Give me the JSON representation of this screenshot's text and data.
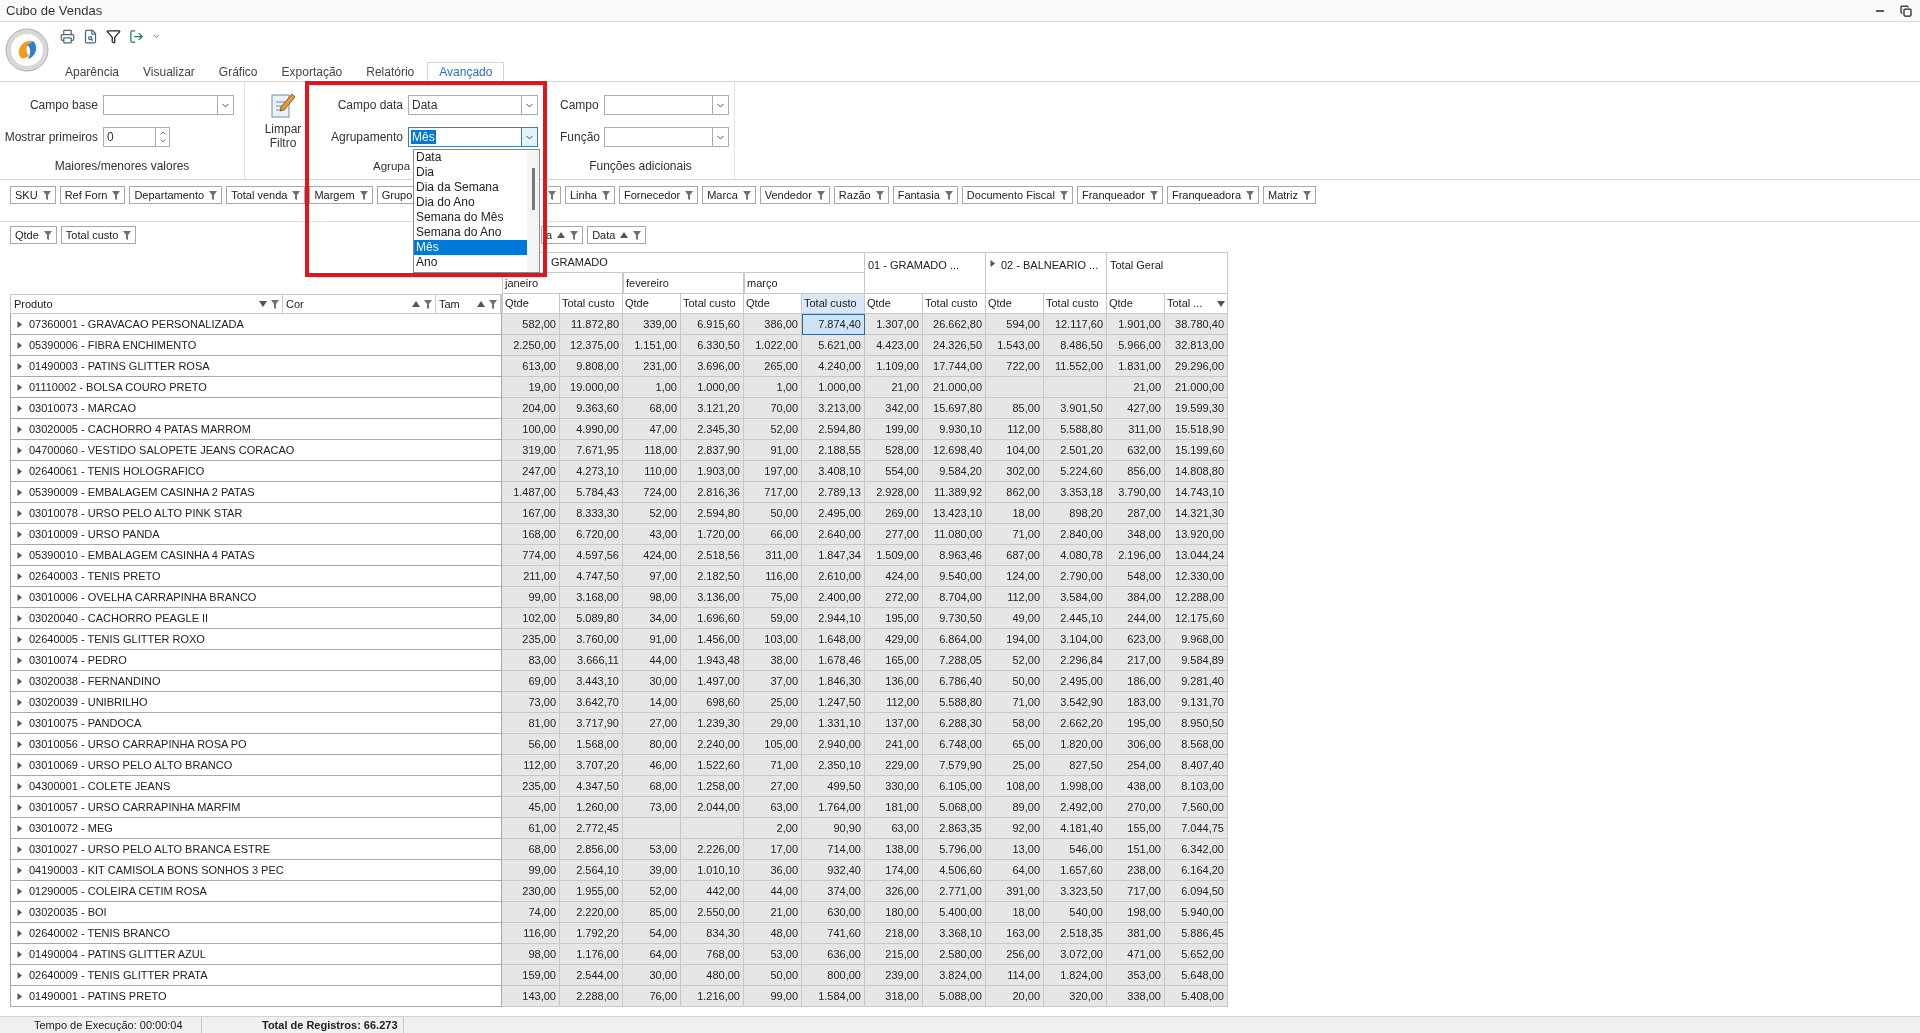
{
  "window": {
    "title": "Cubo de Vendas"
  },
  "tabs": [
    {
      "label": "Aparência",
      "selected": false
    },
    {
      "label": "Visualizar",
      "selected": false
    },
    {
      "label": "Gráfico",
      "selected": false
    },
    {
      "label": "Exportação",
      "selected": false
    },
    {
      "label": "Relatório",
      "selected": false
    },
    {
      "label": "Avançado",
      "selected": true
    }
  ],
  "top_values": {
    "caption": "Maiores/menores valores",
    "base_field": {
      "label": "Campo base"
    },
    "show_first": {
      "label": "Mostrar primeiros",
      "value": "0"
    }
  },
  "clear_filter": {
    "label": "Limpar Filtro"
  },
  "date_grouping": {
    "caption": "Agrupa",
    "date_field": {
      "label": "Campo data",
      "value": "Data"
    },
    "grouping": {
      "label": "Agrupamento",
      "value": "Mês",
      "expanded": true,
      "options": [
        {
          "label": "Data",
          "selected": false
        },
        {
          "label": "Dia",
          "selected": false
        },
        {
          "label": "Dia da Semana",
          "selected": false
        },
        {
          "label": "Dia do Ano",
          "selected": false
        },
        {
          "label": "Semana do Mês",
          "selected": false
        },
        {
          "label": "Semana do Ano",
          "selected": false
        },
        {
          "label": "Mês",
          "selected": true
        },
        {
          "label": "Ano",
          "selected": false
        }
      ]
    }
  },
  "extra_functions": {
    "caption": "Funções adicionais",
    "field": {
      "label": "Campo"
    },
    "function": {
      "label": "Função"
    }
  },
  "filter_fields_left": [
    "SKU",
    "Ref Forn",
    "Departamento",
    "Total venda",
    "Margem",
    "Grupo"
  ],
  "filter_fields_right": [
    "Linha",
    "Fornecedor",
    "Marca",
    "Vendedor",
    "Razão",
    "Fantasia",
    "Documento Fiscal",
    "Franqueador",
    "Franqueadora",
    "Matriz"
  ],
  "data_fields": [
    "Qtde",
    "Total custo"
  ],
  "column_fields": [
    {
      "label": "a",
      "sort_ascending": true
    },
    {
      "label": "Data",
      "sort_ascending": true
    }
  ],
  "pivot": {
    "row_fields": [
      {
        "label": "Produto",
        "sort_ascending": false
      },
      {
        "label": "Cor",
        "sort_ascending": true
      },
      {
        "label": "Tam",
        "sort_ascending": true
      }
    ],
    "store_header": "GRAMADO",
    "months": [
      "janeiro",
      "fevereiro",
      "março"
    ],
    "totals": [
      {
        "label": "01 - GRAMADO ..."
      },
      {
        "label": "02 - BALNEARIO ...",
        "expanded": false
      },
      {
        "label": "Total Geral"
      }
    ],
    "measures": [
      {
        "label": "Qtde",
        "selected": false
      },
      {
        "label": "Total custo",
        "selected": false
      },
      {
        "label": "Qtde",
        "selected": false
      },
      {
        "label": "Total custo",
        "selected": false
      },
      {
        "label": "Qtde",
        "selected": false
      },
      {
        "label": "Total custo",
        "selected": true
      },
      {
        "label": "Qtde",
        "selected": false
      },
      {
        "label": "Total custo",
        "selected": false
      },
      {
        "label": "Qtde",
        "selected": false
      },
      {
        "label": "Total custo",
        "selected": false
      },
      {
        "label": "Qtde",
        "selected": false
      },
      {
        "label": "Total ...",
        "selected": false,
        "sort_ascending": false
      }
    ],
    "rows": [
      {
        "product": "07360001 - GRAVACAO PERSONALIZADA",
        "expanded": false,
        "selected": true,
        "janeiro": [
          "582,00",
          "11.872,80"
        ],
        "fevereiro": [
          "339,00",
          "6.915,60"
        ],
        "marco": [
          "386,00",
          "7.874,40"
        ],
        "gramado_total": [
          "1.307,00",
          "26.662,80"
        ],
        "balneario_total": [
          "594,00",
          "12.117,60"
        ],
        "total_geral": [
          "1.901,00",
          "38.780,40"
        ]
      },
      {
        "product": "05390006 - FIBRA ENCHIMENTO",
        "expanded": false,
        "selected": false,
        "janeiro": [
          "2.250,00",
          "12.375,00"
        ],
        "fevereiro": [
          "1.151,00",
          "6.330,50"
        ],
        "marco": [
          "1.022,00",
          "5.621,00"
        ],
        "gramado_total": [
          "4.423,00",
          "24.326,50"
        ],
        "balneario_total": [
          "1.543,00",
          "8.486,50"
        ],
        "total_geral": [
          "5.966,00",
          "32.813,00"
        ]
      },
      {
        "product": "01490003 - PATINS GLITTER ROSA",
        "expanded": false,
        "selected": false,
        "janeiro": [
          "613,00",
          "9.808,00"
        ],
        "fevereiro": [
          "231,00",
          "3.696,00"
        ],
        "marco": [
          "265,00",
          "4.240,00"
        ],
        "gramado_total": [
          "1.109,00",
          "17.744,00"
        ],
        "balneario_total": [
          "722,00",
          "11.552,00"
        ],
        "total_geral": [
          "1.831,00",
          "29.296,00"
        ]
      },
      {
        "product": "01110002 - BOLSA COURO PRETO",
        "expanded": false,
        "selected": false,
        "janeiro": [
          "19,00",
          "19.000,00"
        ],
        "fevereiro": [
          "1,00",
          "1.000,00"
        ],
        "marco": [
          "1,00",
          "1.000,00"
        ],
        "gramado_total": [
          "21,00",
          "21.000,00"
        ],
        "total_geral": [
          "21,00",
          "21.000,00"
        ]
      },
      {
        "product": "03010073 - MARCAO",
        "expanded": false,
        "selected": false,
        "janeiro": [
          "204,00",
          "9.363,60"
        ],
        "fevereiro": [
          "68,00",
          "3.121,20"
        ],
        "marco": [
          "70,00",
          "3.213,00"
        ],
        "gramado_total": [
          "342,00",
          "15.697,80"
        ],
        "balneario_total": [
          "85,00",
          "3.901,50"
        ],
        "total_geral": [
          "427,00",
          "19.599,30"
        ]
      },
      {
        "product": "03020005 - CACHORRO 4 PATAS MARROM",
        "expanded": false,
        "selected": false,
        "janeiro": [
          "100,00",
          "4.990,00"
        ],
        "fevereiro": [
          "47,00",
          "2.345,30"
        ],
        "marco": [
          "52,00",
          "2.594,80"
        ],
        "gramado_total": [
          "199,00",
          "9.930,10"
        ],
        "balneario_total": [
          "112,00",
          "5.588,80"
        ],
        "total_geral": [
          "311,00",
          "15.518,90"
        ]
      },
      {
        "product": "04700060 - VESTIDO SALOPETE JEANS CORACAO",
        "expanded": false,
        "selected": false,
        "janeiro": [
          "319,00",
          "7.671,95"
        ],
        "fevereiro": [
          "118,00",
          "2.837,90"
        ],
        "marco": [
          "91,00",
          "2.188,55"
        ],
        "gramado_total": [
          "528,00",
          "12.698,40"
        ],
        "balneario_total": [
          "104,00",
          "2.501,20"
        ],
        "total_geral": [
          "632,00",
          "15.199,60"
        ]
      },
      {
        "product": "02640061 - TENIS HOLOGRAFICO",
        "expanded": false,
        "selected": false,
        "janeiro": [
          "247,00",
          "4.273,10"
        ],
        "fevereiro": [
          "110,00",
          "1.903,00"
        ],
        "marco": [
          "197,00",
          "3.408,10"
        ],
        "gramado_total": [
          "554,00",
          "9.584,20"
        ],
        "balneario_total": [
          "302,00",
          "5.224,60"
        ],
        "total_geral": [
          "856,00",
          "14.808,80"
        ]
      },
      {
        "product": "05390009 - EMBALAGEM CASINHA 2 PATAS",
        "expanded": false,
        "selected": false,
        "janeiro": [
          "1.487,00",
          "5.784,43"
        ],
        "fevereiro": [
          "724,00",
          "2.816,36"
        ],
        "marco": [
          "717,00",
          "2.789,13"
        ],
        "gramado_total": [
          "2.928,00",
          "11.389,92"
        ],
        "balneario_total": [
          "862,00",
          "3.353,18"
        ],
        "total_geral": [
          "3.790,00",
          "14.743,10"
        ]
      },
      {
        "product": "03010078 - URSO PELO ALTO PINK STAR",
        "expanded": false,
        "selected": false,
        "janeiro": [
          "167,00",
          "8.333,30"
        ],
        "fevereiro": [
          "52,00",
          "2.594,80"
        ],
        "marco": [
          "50,00",
          "2.495,00"
        ],
        "gramado_total": [
          "269,00",
          "13.423,10"
        ],
        "balneario_total": [
          "18,00",
          "898,20"
        ],
        "total_geral": [
          "287,00",
          "14.321,30"
        ]
      },
      {
        "product": "03010009 - URSO PANDA",
        "expanded": false,
        "selected": false,
        "janeiro": [
          "168,00",
          "6.720,00"
        ],
        "fevereiro": [
          "43,00",
          "1.720,00"
        ],
        "marco": [
          "66,00",
          "2.640,00"
        ],
        "gramado_total": [
          "277,00",
          "11.080,00"
        ],
        "balneario_total": [
          "71,00",
          "2.840,00"
        ],
        "total_geral": [
          "348,00",
          "13.920,00"
        ]
      },
      {
        "product": "05390010 - EMBALAGEM CASINHA 4 PATAS",
        "expanded": false,
        "selected": false,
        "janeiro": [
          "774,00",
          "4.597,56"
        ],
        "fevereiro": [
          "424,00",
          "2.518,56"
        ],
        "marco": [
          "311,00",
          "1.847,34"
        ],
        "gramado_total": [
          "1.509,00",
          "8.963,46"
        ],
        "balneario_total": [
          "687,00",
          "4.080,78"
        ],
        "total_geral": [
          "2.196,00",
          "13.044,24"
        ]
      },
      {
        "product": "02640003 - TENIS PRETO",
        "expanded": false,
        "selected": false,
        "janeiro": [
          "211,00",
          "4.747,50"
        ],
        "fevereiro": [
          "97,00",
          "2.182,50"
        ],
        "marco": [
          "116,00",
          "2.610,00"
        ],
        "gramado_total": [
          "424,00",
          "9.540,00"
        ],
        "balneario_total": [
          "124,00",
          "2.790,00"
        ],
        "total_geral": [
          "548,00",
          "12.330,00"
        ]
      },
      {
        "product": "03010006 - OVELHA CARRAPINHA BRANCO",
        "expanded": false,
        "selected": false,
        "janeiro": [
          "99,00",
          "3.168,00"
        ],
        "fevereiro": [
          "98,00",
          "3.136,00"
        ],
        "marco": [
          "75,00",
          "2.400,00"
        ],
        "gramado_total": [
          "272,00",
          "8.704,00"
        ],
        "balneario_total": [
          "112,00",
          "3.584,00"
        ],
        "total_geral": [
          "384,00",
          "12.288,00"
        ]
      },
      {
        "product": "03020040 - CACHORRO PEAGLE II",
        "expanded": false,
        "selected": false,
        "janeiro": [
          "102,00",
          "5.089,80"
        ],
        "fevereiro": [
          "34,00",
          "1.696,60"
        ],
        "marco": [
          "59,00",
          "2.944,10"
        ],
        "gramado_total": [
          "195,00",
          "9.730,50"
        ],
        "balneario_total": [
          "49,00",
          "2.445,10"
        ],
        "total_geral": [
          "244,00",
          "12.175,60"
        ]
      },
      {
        "product": "02640005 - TENIS GLITTER ROXO",
        "expanded": false,
        "selected": false,
        "janeiro": [
          "235,00",
          "3.760,00"
        ],
        "fevereiro": [
          "91,00",
          "1.456,00"
        ],
        "marco": [
          "103,00",
          "1.648,00"
        ],
        "gramado_total": [
          "429,00",
          "6.864,00"
        ],
        "balneario_total": [
          "194,00",
          "3.104,00"
        ],
        "total_geral": [
          "623,00",
          "9.968,00"
        ]
      },
      {
        "product": "03010074 - PEDRO",
        "expanded": false,
        "selected": false,
        "janeiro": [
          "83,00",
          "3.666,11"
        ],
        "fevereiro": [
          "44,00",
          "1.943,48"
        ],
        "marco": [
          "38,00",
          "1.678,46"
        ],
        "gramado_total": [
          "165,00",
          "7.288,05"
        ],
        "balneario_total": [
          "52,00",
          "2.296,84"
        ],
        "total_geral": [
          "217,00",
          "9.584,89"
        ]
      },
      {
        "product": "03020038 - FERNANDINO",
        "expanded": false,
        "selected": false,
        "janeiro": [
          "69,00",
          "3.443,10"
        ],
        "fevereiro": [
          "30,00",
          "1.497,00"
        ],
        "marco": [
          "37,00",
          "1.846,30"
        ],
        "gramado_total": [
          "136,00",
          "6.786,40"
        ],
        "balneario_total": [
          "50,00",
          "2.495,00"
        ],
        "total_geral": [
          "186,00",
          "9.281,40"
        ]
      },
      {
        "product": "03020039 - UNIBRILHO",
        "expanded": false,
        "selected": false,
        "janeiro": [
          "73,00",
          "3.642,70"
        ],
        "fevereiro": [
          "14,00",
          "698,60"
        ],
        "marco": [
          "25,00",
          "1.247,50"
        ],
        "gramado_total": [
          "112,00",
          "5.588,80"
        ],
        "balneario_total": [
          "71,00",
          "3.542,90"
        ],
        "total_geral": [
          "183,00",
          "9.131,70"
        ]
      },
      {
        "product": "03010075 - PANDOCA",
        "expanded": false,
        "selected": false,
        "janeiro": [
          "81,00",
          "3.717,90"
        ],
        "fevereiro": [
          "27,00",
          "1.239,30"
        ],
        "marco": [
          "29,00",
          "1.331,10"
        ],
        "gramado_total": [
          "137,00",
          "6.288,30"
        ],
        "balneario_total": [
          "58,00",
          "2.662,20"
        ],
        "total_geral": [
          "195,00",
          "8.950,50"
        ]
      },
      {
        "product": "03010056 - URSO CARRAPINHA ROSA PO",
        "expanded": false,
        "selected": false,
        "janeiro": [
          "56,00",
          "1.568,00"
        ],
        "fevereiro": [
          "80,00",
          "2.240,00"
        ],
        "marco": [
          "105,00",
          "2.940,00"
        ],
        "gramado_total": [
          "241,00",
          "6.748,00"
        ],
        "balneario_total": [
          "65,00",
          "1.820,00"
        ],
        "total_geral": [
          "306,00",
          "8.568,00"
        ]
      },
      {
        "product": "03010069 - URSO PELO ALTO BRANCO",
        "expanded": false,
        "selected": false,
        "janeiro": [
          "112,00",
          "3.707,20"
        ],
        "fevereiro": [
          "46,00",
          "1.522,60"
        ],
        "marco": [
          "71,00",
          "2.350,10"
        ],
        "gramado_total": [
          "229,00",
          "7.579,90"
        ],
        "balneario_total": [
          "25,00",
          "827,50"
        ],
        "total_geral": [
          "254,00",
          "8.407,40"
        ]
      },
      {
        "product": "04300001 - COLETE JEANS",
        "expanded": false,
        "selected": false,
        "janeiro": [
          "235,00",
          "4.347,50"
        ],
        "fevereiro": [
          "68,00",
          "1.258,00"
        ],
        "marco": [
          "27,00",
          "499,50"
        ],
        "gramado_total": [
          "330,00",
          "6.105,00"
        ],
        "balneario_total": [
          "108,00",
          "1.998,00"
        ],
        "total_geral": [
          "438,00",
          "8.103,00"
        ]
      },
      {
        "product": "03010057 - URSO CARRAPINHA MARFIM",
        "expanded": false,
        "selected": false,
        "janeiro": [
          "45,00",
          "1.260,00"
        ],
        "fevereiro": [
          "73,00",
          "2.044,00"
        ],
        "marco": [
          "63,00",
          "1.764,00"
        ],
        "gramado_total": [
          "181,00",
          "5.068,00"
        ],
        "balneario_total": [
          "89,00",
          "2.492,00"
        ],
        "total_geral": [
          "270,00",
          "7.560,00"
        ]
      },
      {
        "product": "03010072 - MEG",
        "expanded": false,
        "selected": false,
        "janeiro": [
          "61,00",
          "2.772,45"
        ],
        "marco": [
          "2,00",
          "90,90"
        ],
        "gramado_total": [
          "63,00",
          "2.863,35"
        ],
        "balneario_total": [
          "92,00",
          "4.181,40"
        ],
        "total_geral": [
          "155,00",
          "7.044,75"
        ]
      },
      {
        "product": "03010027 - URSO PELO ALTO BRANCA ESTRE",
        "expanded": false,
        "selected": false,
        "janeiro": [
          "68,00",
          "2.856,00"
        ],
        "fevereiro": [
          "53,00",
          "2.226,00"
        ],
        "marco": [
          "17,00",
          "714,00"
        ],
        "gramado_total": [
          "138,00",
          "5.796,00"
        ],
        "balneario_total": [
          "13,00",
          "546,00"
        ],
        "total_geral": [
          "151,00",
          "6.342,00"
        ]
      },
      {
        "product": "04190003 - KIT CAMISOLA BONS SONHOS 3 PEC",
        "expanded": false,
        "selected": false,
        "janeiro": [
          "99,00",
          "2.564,10"
        ],
        "fevereiro": [
          "39,00",
          "1.010,10"
        ],
        "marco": [
          "36,00",
          "932,40"
        ],
        "gramado_total": [
          "174,00",
          "4.506,60"
        ],
        "balneario_total": [
          "64,00",
          "1.657,60"
        ],
        "total_geral": [
          "238,00",
          "6.164,20"
        ]
      },
      {
        "product": "01290005 - COLEIRA CETIM ROSA",
        "expanded": false,
        "selected": false,
        "janeiro": [
          "230,00",
          "1.955,00"
        ],
        "fevereiro": [
          "52,00",
          "442,00"
        ],
        "marco": [
          "44,00",
          "374,00"
        ],
        "gramado_total": [
          "326,00",
          "2.771,00"
        ],
        "balneario_total": [
          "391,00",
          "3.323,50"
        ],
        "total_geral": [
          "717,00",
          "6.094,50"
        ]
      },
      {
        "product": "03020035 - BOI",
        "expanded": false,
        "selected": false,
        "janeiro": [
          "74,00",
          "2.220,00"
        ],
        "fevereiro": [
          "85,00",
          "2.550,00"
        ],
        "marco": [
          "21,00",
          "630,00"
        ],
        "gramado_total": [
          "180,00",
          "5.400,00"
        ],
        "balneario_total": [
          "18,00",
          "540,00"
        ],
        "total_geral": [
          "198,00",
          "5.940,00"
        ]
      },
      {
        "product": "02640002 - TENIS BRANCO",
        "expanded": false,
        "selected": false,
        "janeiro": [
          "116,00",
          "1.792,20"
        ],
        "fevereiro": [
          "54,00",
          "834,30"
        ],
        "marco": [
          "48,00",
          "741,60"
        ],
        "gramado_total": [
          "218,00",
          "3.368,10"
        ],
        "balneario_total": [
          "163,00",
          "2.518,35"
        ],
        "total_geral": [
          "381,00",
          "5.886,45"
        ]
      },
      {
        "product": "01490004 - PATINS GLITTER AZUL",
        "expanded": false,
        "selected": false,
        "janeiro": [
          "98,00",
          "1.176,00"
        ],
        "fevereiro": [
          "64,00",
          "768,00"
        ],
        "marco": [
          "53,00",
          "636,00"
        ],
        "gramado_total": [
          "215,00",
          "2.580,00"
        ],
        "balneario_total": [
          "256,00",
          "3.072,00"
        ],
        "total_geral": [
          "471,00",
          "5.652,00"
        ]
      },
      {
        "product": "02640009 - TENIS GLITTER PRATA",
        "expanded": false,
        "selected": false,
        "janeiro": [
          "159,00",
          "2.544,00"
        ],
        "fevereiro": [
          "30,00",
          "480,00"
        ],
        "marco": [
          "50,00",
          "800,00"
        ],
        "gramado_total": [
          "239,00",
          "3.824,00"
        ],
        "balneario_total": [
          "114,00",
          "1.824,00"
        ],
        "total_geral": [
          "353,00",
          "5.648,00"
        ]
      },
      {
        "product": "01490001 - PATINS PRETO",
        "expanded": false,
        "selected": false,
        "janeiro": [
          "143,00",
          "2.288,00"
        ],
        "fevereiro": [
          "76,00",
          "1.216,00"
        ],
        "marco": [
          "99,00",
          "1.584,00"
        ],
        "gramado_total": [
          "318,00",
          "5.088,00"
        ],
        "balneario_total": [
          "20,00",
          "320,00"
        ],
        "total_geral": [
          "338,00",
          "5.408,00"
        ]
      }
    ]
  },
  "status_bar": {
    "time": "Tempo de Execução: 00:00:04",
    "records": "Total de Registros: 66.273"
  }
}
